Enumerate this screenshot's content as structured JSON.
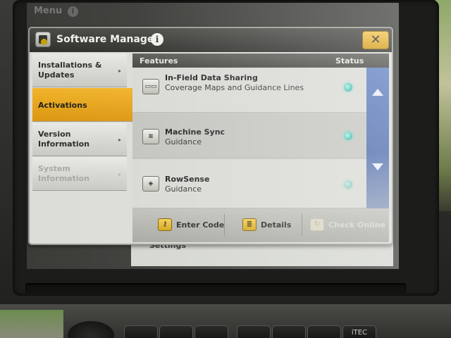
{
  "background": {
    "title": "Menu",
    "info_glyph": "i",
    "bottom_label": "Settings"
  },
  "dialog": {
    "title": "Software Manager",
    "info_glyph": "i",
    "close_glyph": "✕",
    "accent_color": "#e6a31c"
  },
  "sidebar": {
    "items": [
      {
        "label": "Installations & Updates",
        "state": "normal"
      },
      {
        "label": "Activations",
        "state": "active"
      },
      {
        "label": "Version Information",
        "state": "normal"
      },
      {
        "label": "System Information",
        "state": "disabled"
      }
    ],
    "chevron": "▸"
  },
  "features": {
    "header_features": "Features",
    "header_status": "Status",
    "rows": [
      {
        "name": "In-Field Data Sharing",
        "desc": "Coverage Maps and Guidance Lines",
        "icon": "data-sharing-icon",
        "icon_glyph": "▭▭",
        "status": "active"
      },
      {
        "name": "Machine Sync",
        "desc": "Guidance",
        "icon": "machine-sync-icon",
        "icon_glyph": "≋",
        "status": "active"
      },
      {
        "name": "RowSense",
        "desc": "Guidance",
        "icon": "rowsense-icon",
        "icon_glyph": "◈",
        "status": "active"
      }
    ],
    "status_color": "#41b8a7"
  },
  "footer": {
    "enter_code": "Enter Code",
    "details": "Details",
    "check_online": "Check Online",
    "key_glyph": "⚷",
    "details_glyph": "≣",
    "online_glyph": "↻"
  },
  "hardware": {
    "itec_label": "iTEC"
  }
}
